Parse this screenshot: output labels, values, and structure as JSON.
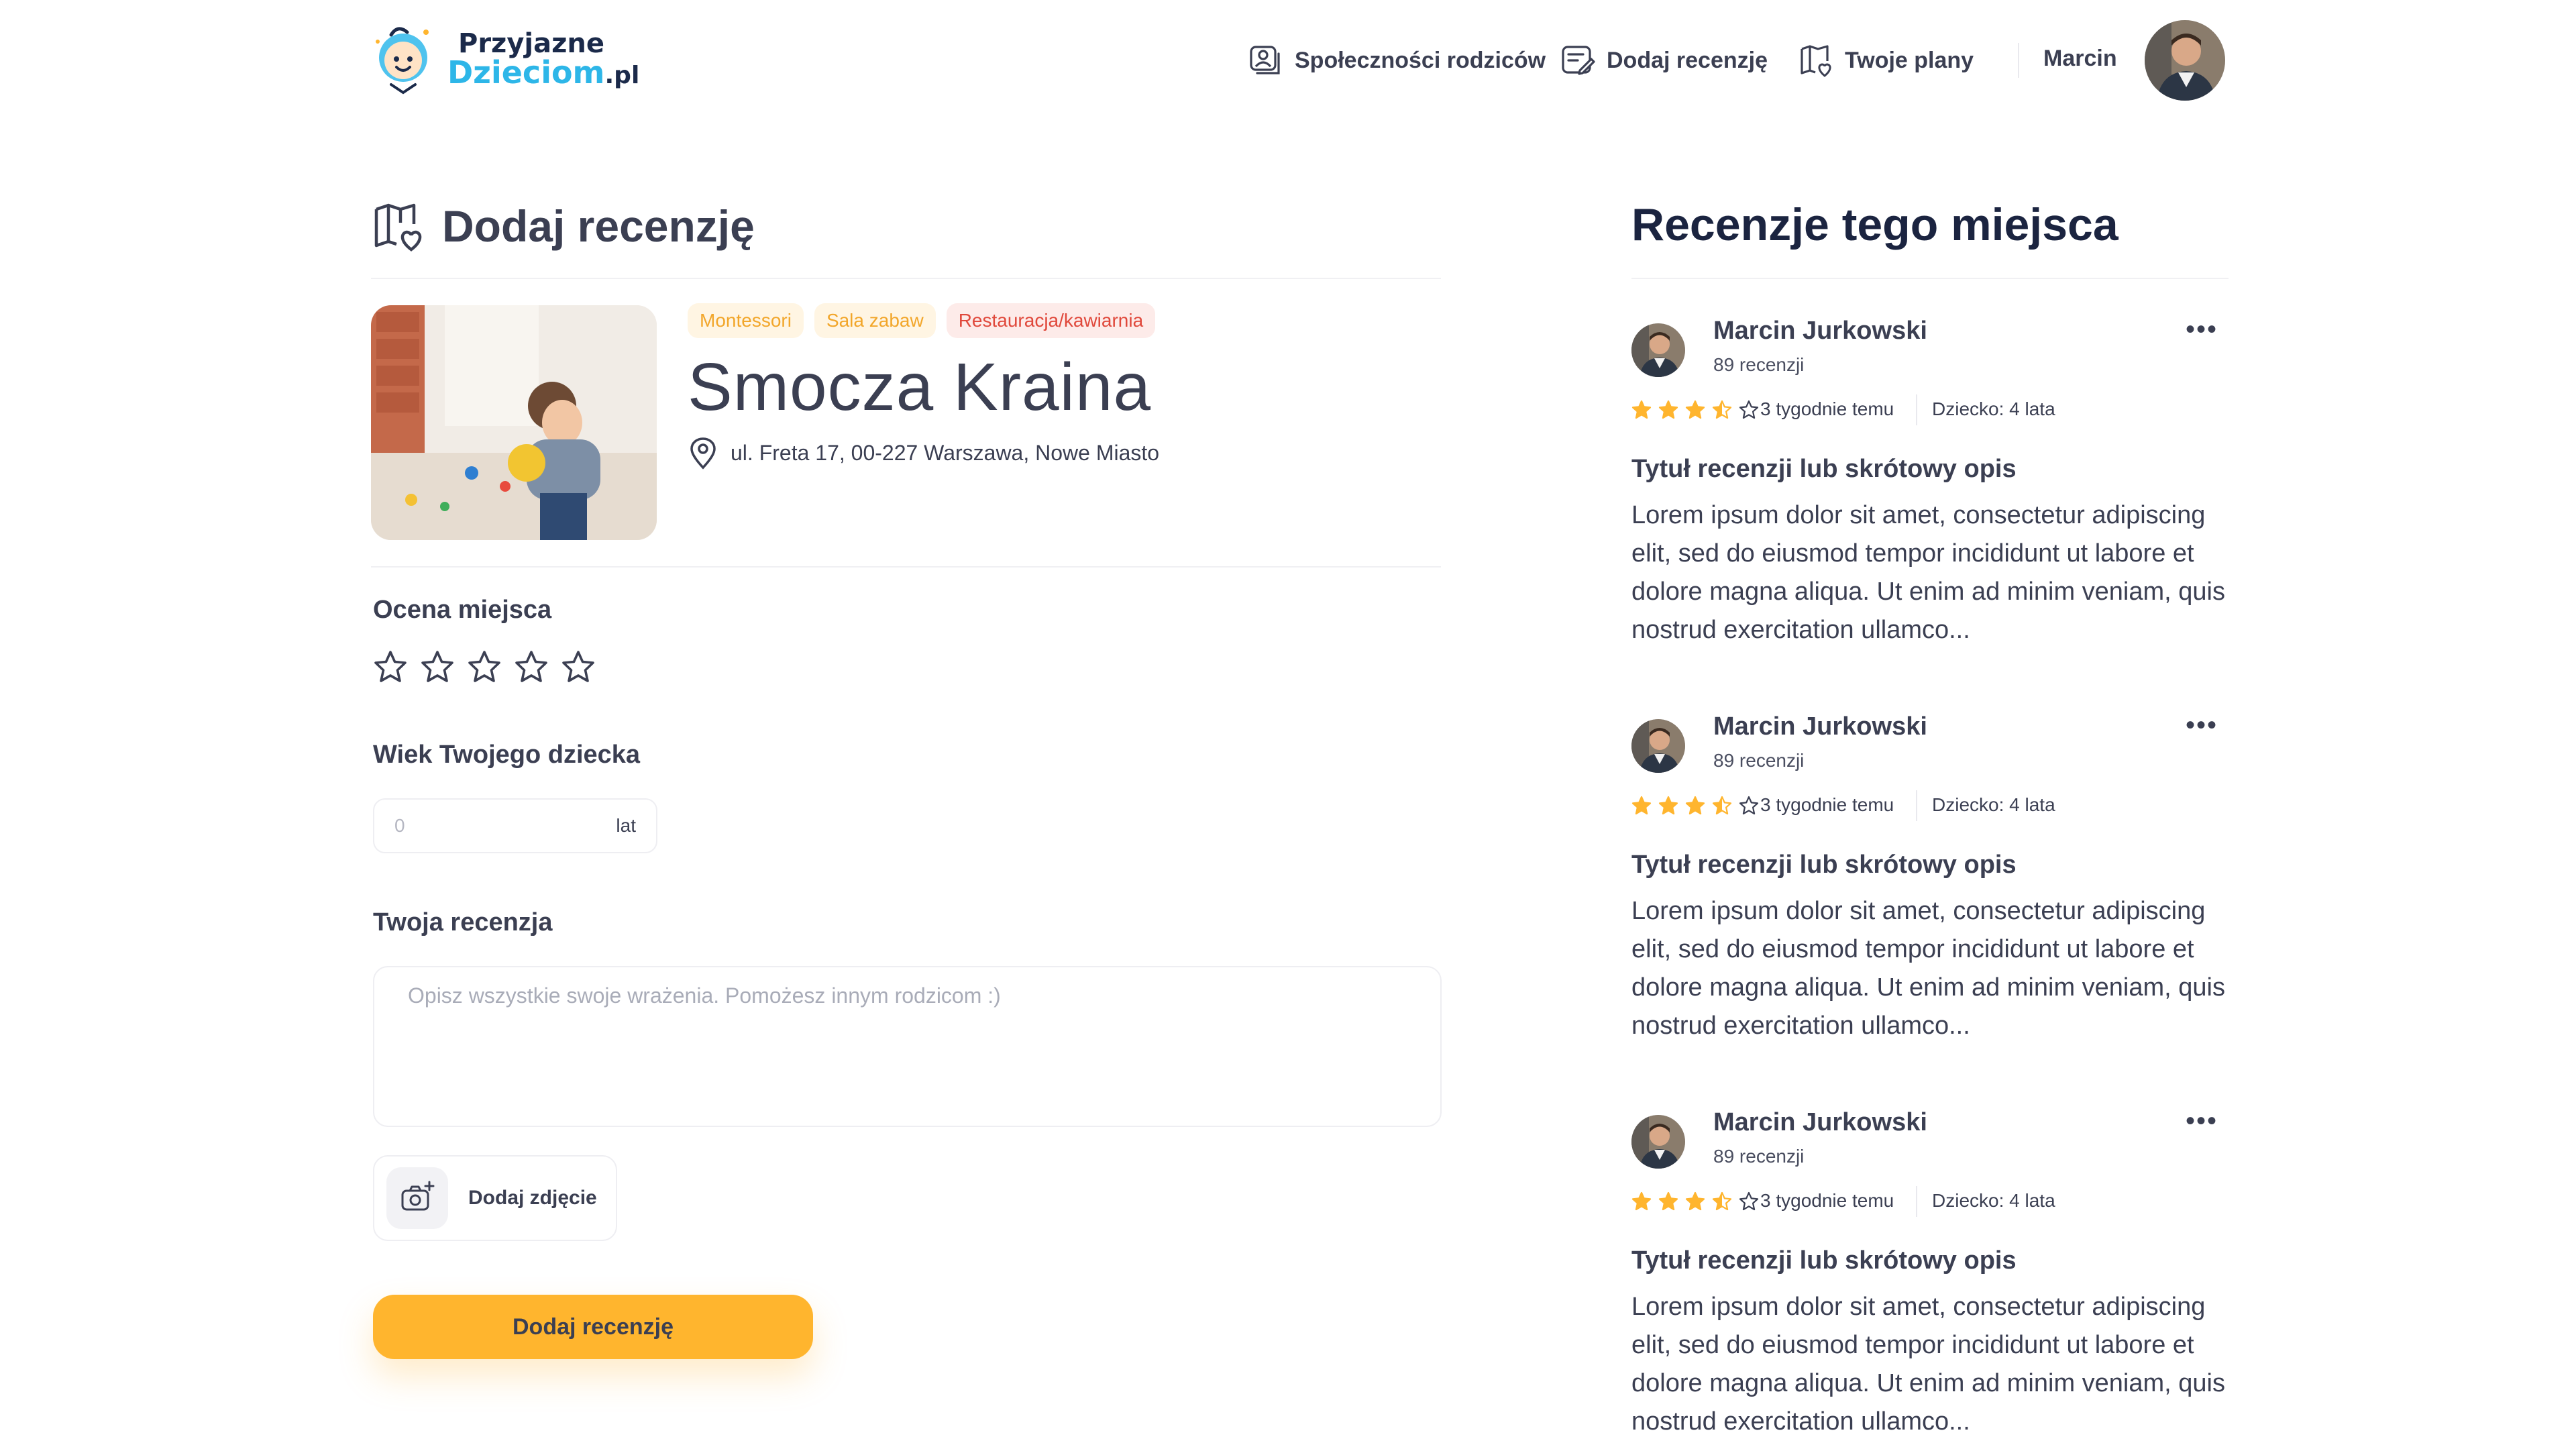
{
  "header": {
    "logo": {
      "line1": "Przyjazne",
      "line2": "Dzieciom",
      "suffix": ".pl"
    },
    "nav": [
      {
        "label": "Społeczności rodziców",
        "icon": "community-icon"
      },
      {
        "label": "Dodaj recenzję",
        "icon": "review-icon"
      },
      {
        "label": "Twoje plany",
        "icon": "plans-icon"
      }
    ],
    "user_name": "Marcin"
  },
  "form": {
    "title": "Dodaj recenzję",
    "place": {
      "tags": [
        "Montessori",
        "Sala zabaw",
        "Restauracja/kawiarnia"
      ],
      "name": "Smocza Kraina",
      "address": "ul. Freta 17, 00-227 Warszawa, Nowe Miasto"
    },
    "rating_label": "Ocena miejsca",
    "rating_value": 0,
    "rating_max": 5,
    "age_label": "Wiek Twojego dziecka",
    "age_placeholder": "0",
    "age_unit": "lat",
    "review_label": "Twoja recenzja",
    "review_placeholder": "Opisz wszystkie swoje wrażenia. Pomożesz innym rodzicom :)",
    "add_photo_label": "Dodaj zdjęcie",
    "submit_label": "Dodaj recenzję"
  },
  "reviews": {
    "title": "Recenzje tego miejsca",
    "menu_label": "•••",
    "items": [
      {
        "author": "Marcin Jurkowski",
        "count": "89 recenzji",
        "rating": 3.5,
        "date": "3 tygodnie temu",
        "child": "Dziecko: 4 lata",
        "title": "Tytuł recenzji lub skrótowy opis",
        "body": "Lorem ipsum dolor sit amet, consectetur adipiscing elit, sed do eiusmod tempor incididunt ut labore et dolore magna aliqua. Ut enim ad minim veniam, quis nostrud exercitation ullamco..."
      },
      {
        "author": "Marcin Jurkowski",
        "count": "89 recenzji",
        "rating": 3.5,
        "date": "3 tygodnie temu",
        "child": "Dziecko: 4 lata",
        "title": "Tytuł recenzji lub skrótowy opis",
        "body": "Lorem ipsum dolor sit amet, consectetur adipiscing elit, sed do eiusmod tempor incididunt ut labore et dolore magna aliqua. Ut enim ad minim veniam, quis nostrud exercitation ullamco..."
      },
      {
        "author": "Marcin Jurkowski",
        "count": "89 recenzji",
        "rating": 3.5,
        "date": "3 tygodnie temu",
        "child": "Dziecko: 4 lata",
        "title": "Tytuł recenzji lub skrótowy opis",
        "body": "Lorem ipsum dolor sit amet, consectetur adipiscing elit, sed do eiusmod tempor incididunt ut labore et dolore magna aliqua. Ut enim ad minim veniam, quis nostrud exercitation ullamco..."
      }
    ]
  },
  "colors": {
    "accent": "#ffb52e",
    "text": "#3b3f52",
    "star_filled": "#ffb52e",
    "tag_yellow": "#f2a62a",
    "tag_red": "#e0483b"
  }
}
